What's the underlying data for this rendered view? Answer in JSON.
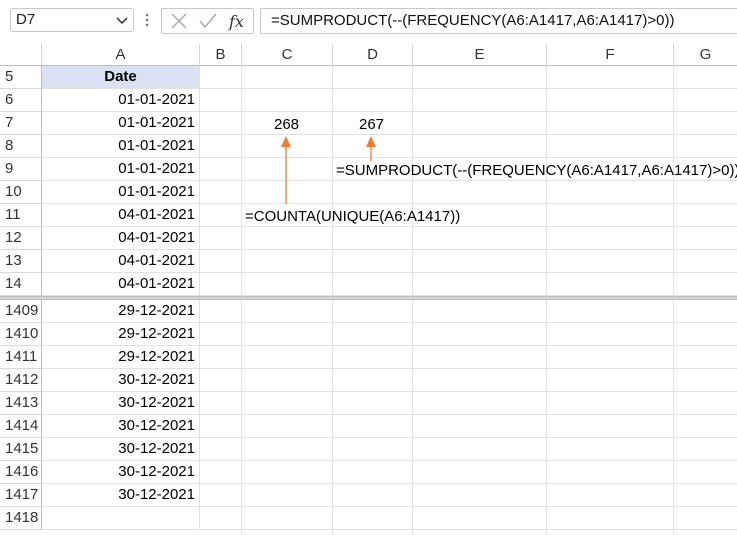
{
  "formula_bar": {
    "name_box": "D7",
    "formula": "=SUMPRODUCT(--(FREQUENCY(A6:A1417,A6:A1417)>0))"
  },
  "columns": [
    "A",
    "B",
    "C",
    "D",
    "E",
    "F",
    "G"
  ],
  "header_cell": "Date",
  "top_rows": [
    {
      "row": "5"
    },
    {
      "row": "6",
      "a": "01-01-2021"
    },
    {
      "row": "7",
      "a": "01-01-2021",
      "c": "268",
      "d": "267"
    },
    {
      "row": "8",
      "a": "01-01-2021"
    },
    {
      "row": "9",
      "a": "01-01-2021"
    },
    {
      "row": "10",
      "a": "01-01-2021"
    },
    {
      "row": "11",
      "a": "04-01-2021"
    },
    {
      "row": "12",
      "a": "04-01-2021"
    },
    {
      "row": "13",
      "a": "04-01-2021"
    },
    {
      "row": "14",
      "a": "04-01-2021"
    }
  ],
  "bottom_rows": [
    {
      "row": "1409",
      "a": "29-12-2021"
    },
    {
      "row": "1410",
      "a": "29-12-2021"
    },
    {
      "row": "1411",
      "a": "29-12-2021"
    },
    {
      "row": "1412",
      "a": "30-12-2021"
    },
    {
      "row": "1413",
      "a": "30-12-2021"
    },
    {
      "row": "1414",
      "a": "30-12-2021"
    },
    {
      "row": "1415",
      "a": "30-12-2021"
    },
    {
      "row": "1416",
      "a": "30-12-2021"
    },
    {
      "row": "1417",
      "a": "30-12-2021"
    },
    {
      "row": "1418",
      "a": ""
    }
  ],
  "annotations": {
    "sumproduct_label": "=SUMPRODUCT(--(FREQUENCY(A6:A1417,A6:A1417)>0))",
    "counta_label": "=COUNTA(UNIQUE(A6:A1417))",
    "arrow_color": "#ed7d31"
  },
  "colors": {
    "header_fill": "#d9e1f2"
  }
}
